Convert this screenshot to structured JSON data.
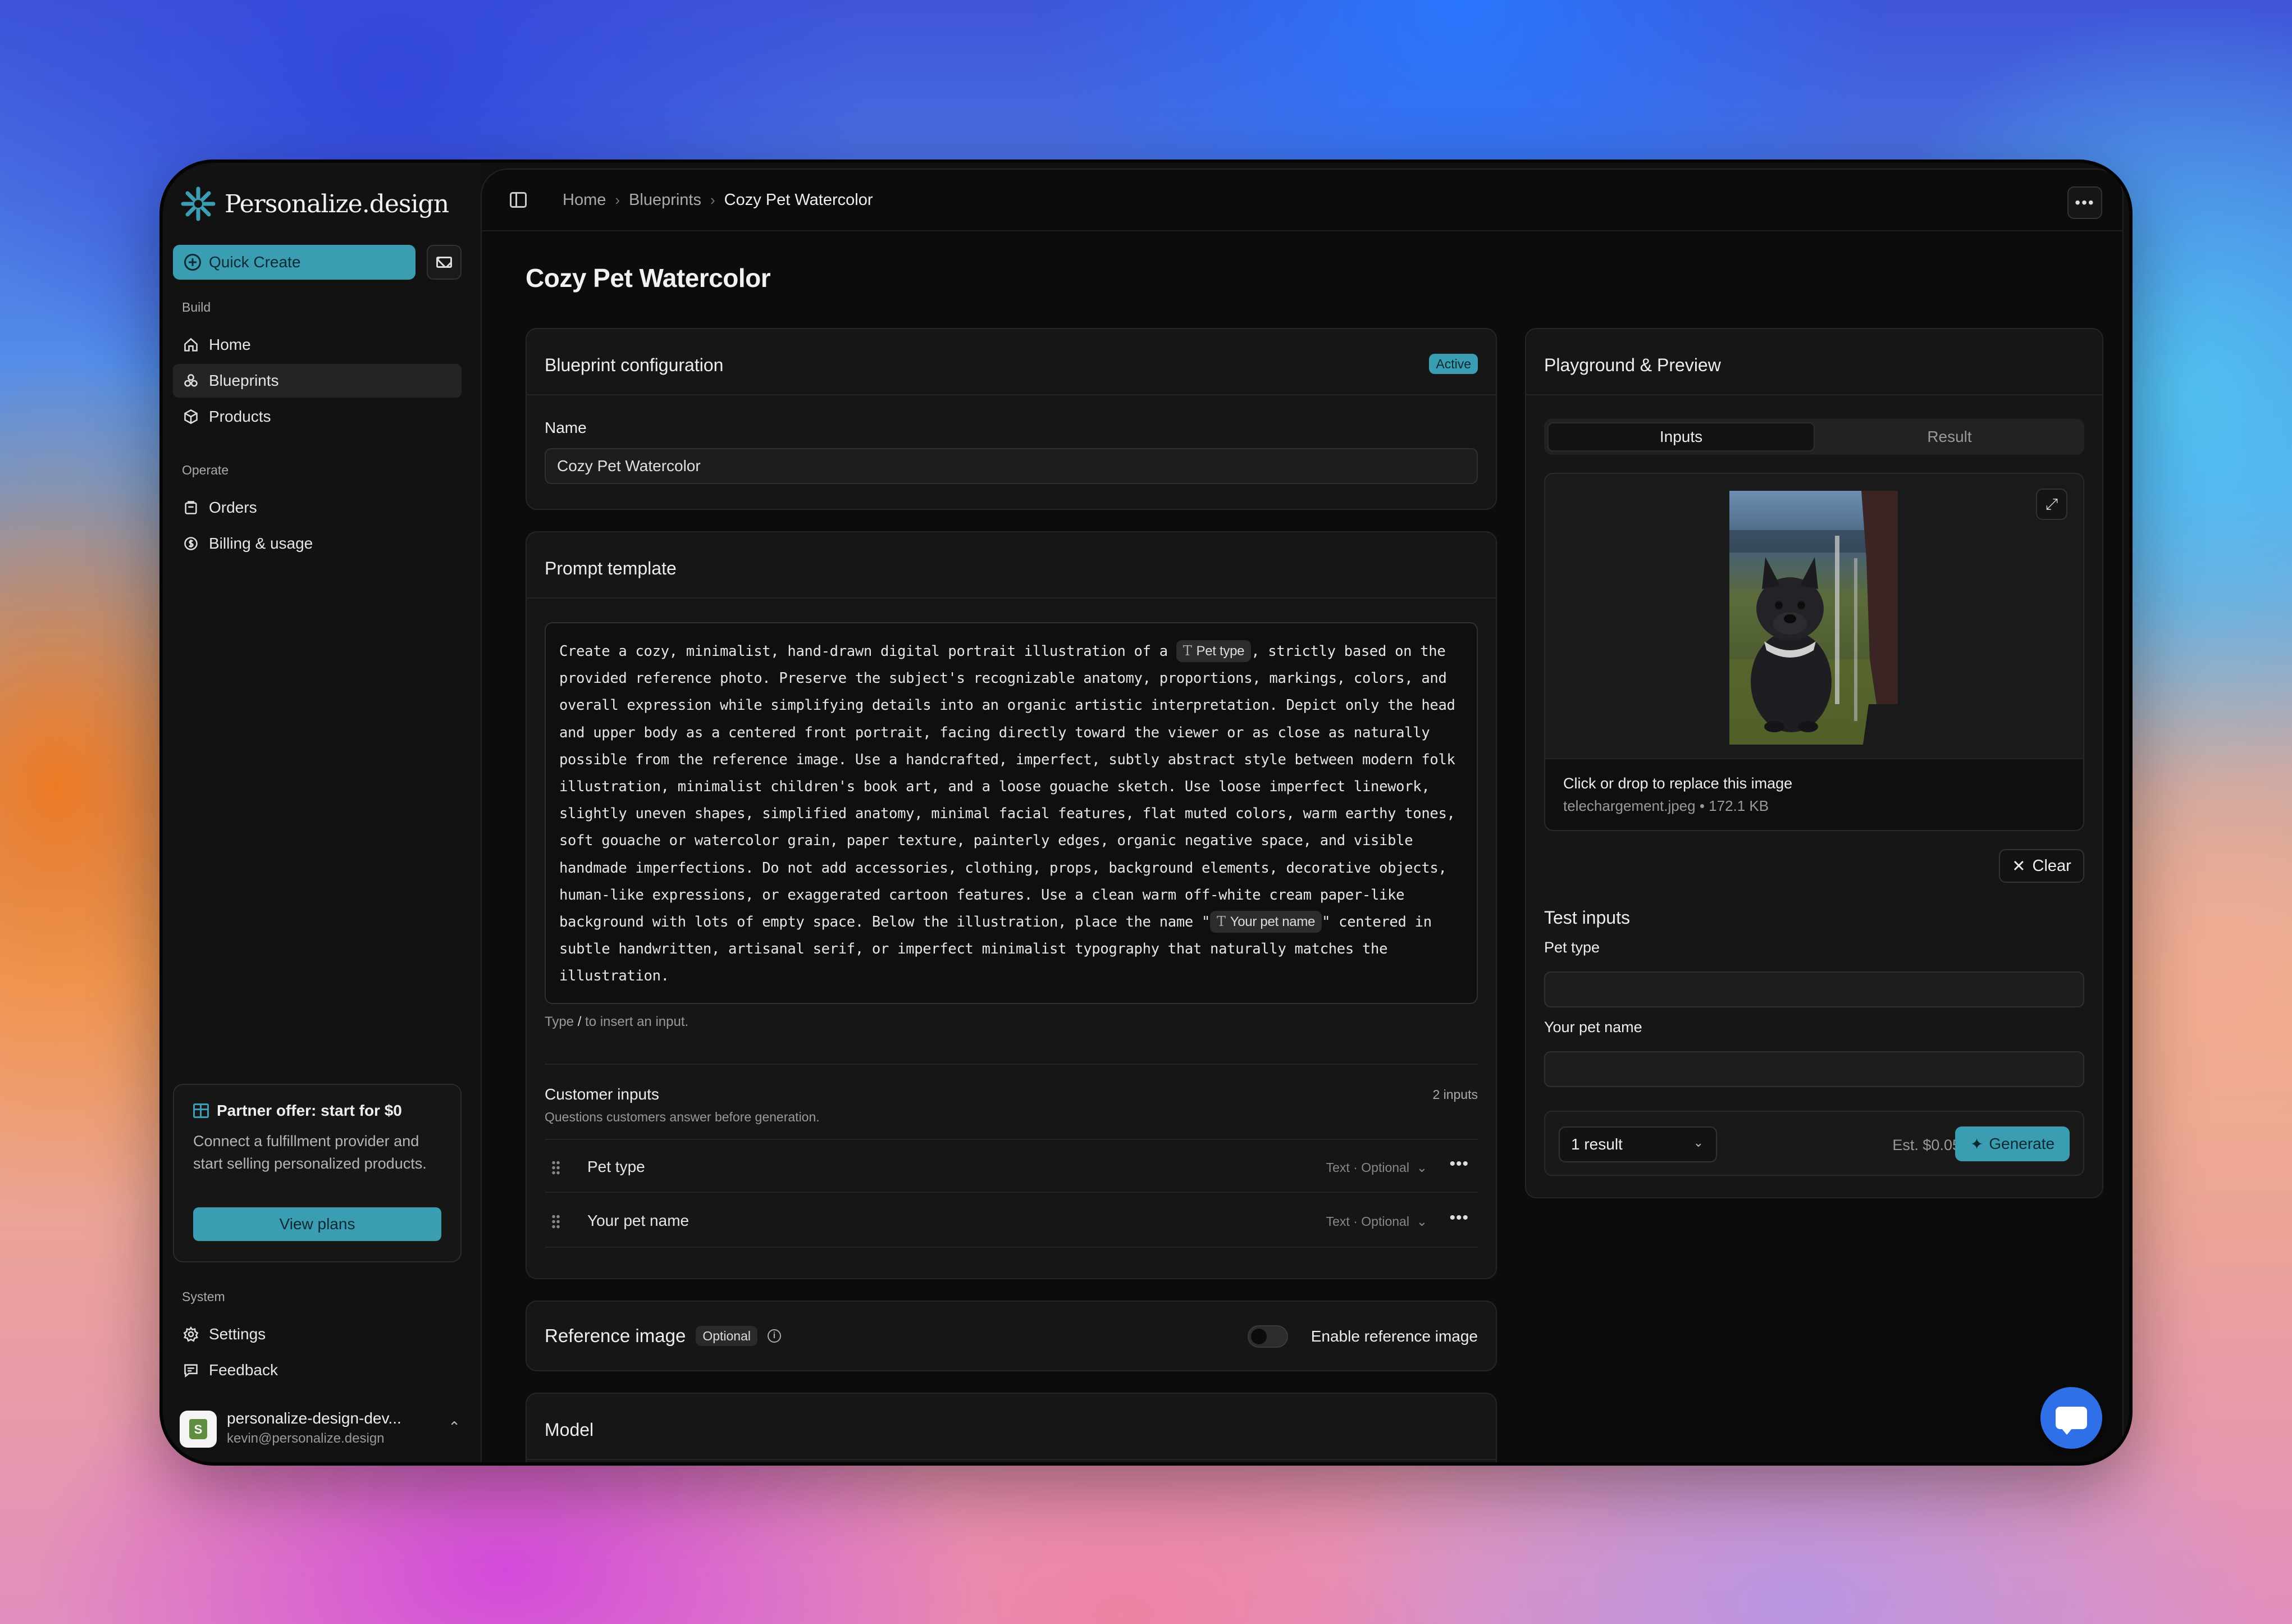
{
  "app": {
    "brand": "Personalize.design"
  },
  "sidebar": {
    "quick_create": "Quick Create",
    "build_label": "Build",
    "build_items": [
      {
        "label": "Home",
        "icon": "home-icon"
      },
      {
        "label": "Blueprints",
        "icon": "blueprints-icon",
        "active": true
      },
      {
        "label": "Products",
        "icon": "box-icon"
      }
    ],
    "operate_label": "Operate",
    "operate_items": [
      {
        "label": "Orders",
        "icon": "orders-icon"
      },
      {
        "label": "Billing & usage",
        "icon": "billing-icon"
      }
    ],
    "partner": {
      "title": "Partner offer: start for $0",
      "text": "Connect a fulfillment provider and start selling personalized products.",
      "button": "View plans"
    },
    "system_label": "System",
    "system_items": [
      {
        "label": "Settings",
        "icon": "gear-icon"
      },
      {
        "label": "Feedback",
        "icon": "feedback-icon"
      }
    ],
    "account": {
      "name": "personalize-design-dev...",
      "email": "kevin@personalize.design"
    }
  },
  "breadcrumb": [
    "Home",
    "Blueprints",
    "Cozy Pet Watercolor"
  ],
  "page": {
    "title": "Cozy Pet Watercolor"
  },
  "blueprint_config": {
    "title": "Blueprint configuration",
    "status": "Active",
    "name_label": "Name",
    "name_value": "Cozy Pet Watercolor"
  },
  "prompt": {
    "title": "Prompt template",
    "text_1": "Create a cozy, minimalist, hand-drawn digital portrait illustration of a ",
    "chip_1": "Pet type",
    "text_2": ", strictly based on the provided reference photo. Preserve the subject's recognizable anatomy, proportions, markings, colors, and overall expression while simplifying details into an organic artistic interpretation. Depict only the head and upper body as a centered front portrait, facing directly toward the viewer or as close as naturally possible from the reference image. Use a handcrafted, imperfect, subtly abstract style between modern folk illustration, minimalist children's book art, and a loose gouache sketch. Use loose imperfect linework, slightly uneven shapes, simplified anatomy, minimal facial features, flat muted colors, warm earthy tones, soft gouache or watercolor grain, paper texture, painterly edges, organic negative space, and visible handmade imperfections. Do not add accessories, clothing, props, background elements, decorative objects, human-like expressions, or exaggerated cartoon features. Use a clean warm off-white cream paper-like background with lots of empty space. Below the illustration, place the name \"",
    "chip_2": "Your pet name",
    "text_3": "\" centered in subtle handwritten, artisanal serif, or imperfect minimalist typography that naturally matches the illustration.",
    "hint_before": "Type ",
    "hint_key": "/",
    "hint_after": " to insert an input."
  },
  "customer_inputs": {
    "title": "Customer inputs",
    "subtitle": "Questions customers answer before generation.",
    "count": "2 inputs",
    "rows": [
      {
        "name": "Pet type",
        "meta": "Text · Optional"
      },
      {
        "name": "Your pet name",
        "meta": "Text · Optional"
      }
    ]
  },
  "reference_image": {
    "title": "Reference image",
    "badge": "Optional",
    "toggle_label": "Enable reference image",
    "enabled": false
  },
  "model": {
    "title": "Model"
  },
  "playground": {
    "title": "Playground & Preview",
    "tabs": [
      "Inputs",
      "Result"
    ],
    "active_tab": "Inputs",
    "drop_text": "Click or drop to replace this image",
    "file_meta": "telechargement.jpeg • 172.1 KB",
    "clear": "Clear",
    "test_inputs_title": "Test inputs",
    "fields": [
      {
        "label": "Pet type",
        "value": ""
      },
      {
        "label": "Your pet name",
        "value": ""
      }
    ],
    "result_count": "1 result",
    "estimate": "Est. $0.05",
    "generate": "Generate"
  },
  "colors": {
    "accent": "#3a9db2",
    "background": "#0c0c0c",
    "sidebar": "#121212"
  }
}
